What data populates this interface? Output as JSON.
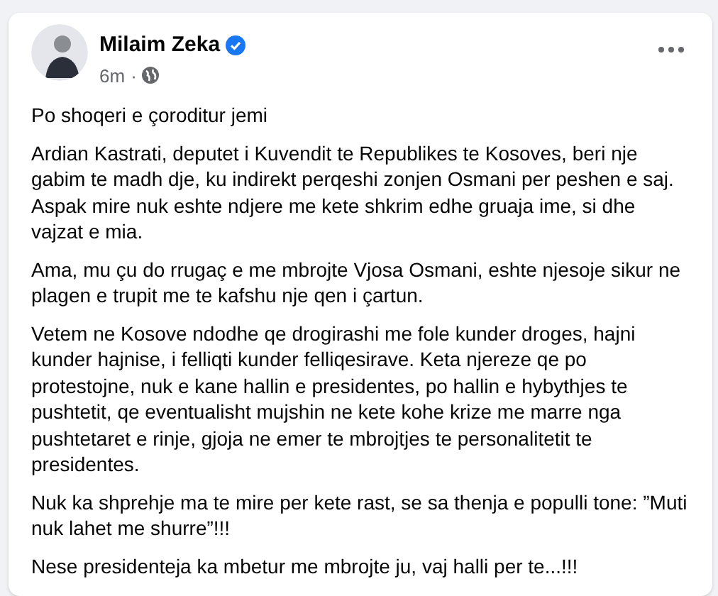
{
  "post": {
    "author": "Milaim Zeka",
    "verified": true,
    "time": "6m",
    "separator": "·",
    "paragraphs": [
      "Po shoqeri e çoroditur jemi",
      "Ardian Kastrati, deputet i Kuvendit te Republikes te Kosoves, beri nje gabim te madh dje, ku indirekt perqeshi zonjen Osmani per peshen e saj. Aspak mire nuk eshte ndjere me kete shkrim edhe gruaja ime, si dhe vajzat e mia.",
      "Ama, mu çu do rrugaç e me mbrojte Vjosa Osmani, eshte njesoje sikur ne plagen e trupit me te kafshu nje qen i çartun.",
      "Vetem ne Kosove ndodhe qe drogirashi me fole kunder droges, hajni kunder hajnise, i felliqti kunder felliqesirave. Keta njereze qe po protestojne, nuk e kane hallin e presidentes, po hallin e hybythjes te pushtetit, qe eventualisht mujshin ne kete kohe krize me marre nga pushtetaret e rinje, gjoja ne emer te mbrojtjes te personalitetit te presidentes.",
      "Nuk ka shprehje ma te mire per kete rast, se sa thenja e populli tone: ”Muti nuk lahet me shurre”!!!",
      "Nese presidenteja ka mbetur me mbrojte ju, vaj halli per te...!!!"
    ]
  }
}
